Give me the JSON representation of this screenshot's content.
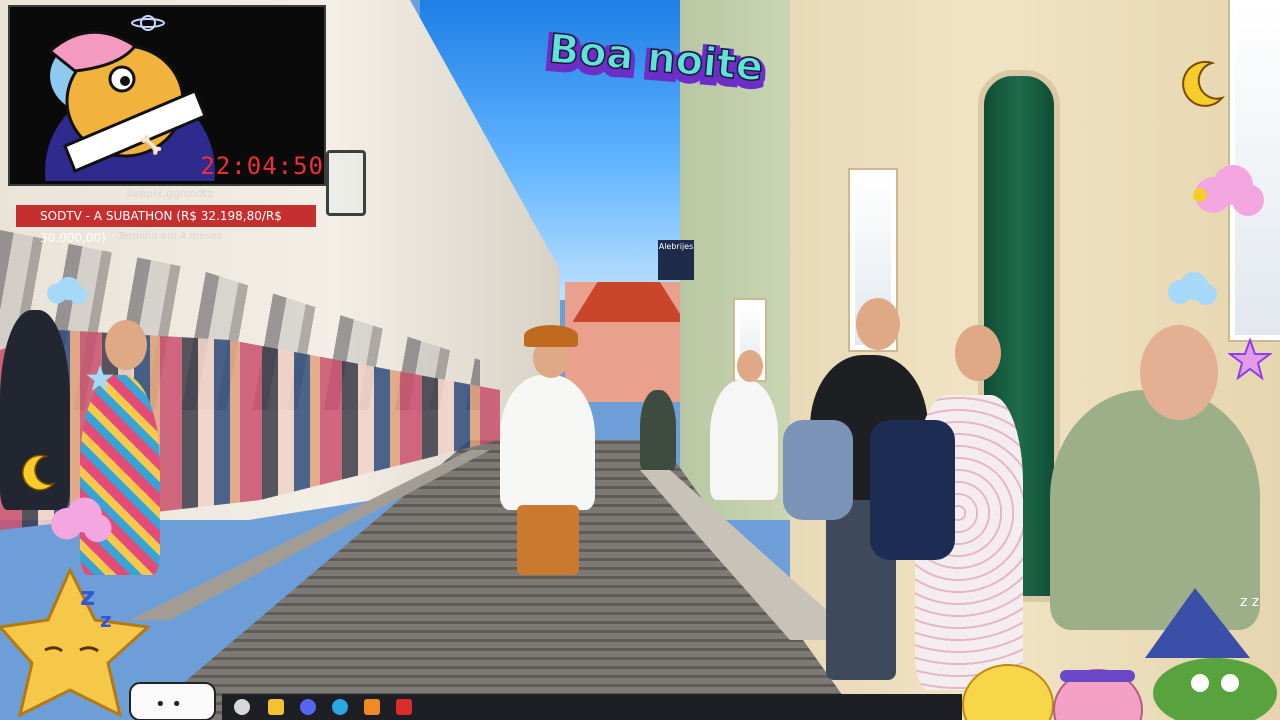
{
  "stream": {
    "timer": "22:04:50",
    "livepix_url": "livepix.gg/sodtz",
    "goal_text": "SODTV - A SUBATHON (R$ 32.198,80/R$ 30.000,00)",
    "goal_subtext": "Termina em 4 meses",
    "greeting": "Boa noite"
  },
  "scene": {
    "shop_sign": "Alebrijes"
  },
  "taskbar": {
    "icons": [
      "emoji-icon",
      "file-explorer-icon",
      "discord-icon",
      "edge-icon",
      "app-icon",
      "app-red-icon"
    ]
  },
  "colors": {
    "goal_bar": "#c62f2f",
    "timer": "#ef2f35",
    "greeting_fill": "#5fe3d7",
    "greeting_outline": "#8a3fe8"
  }
}
